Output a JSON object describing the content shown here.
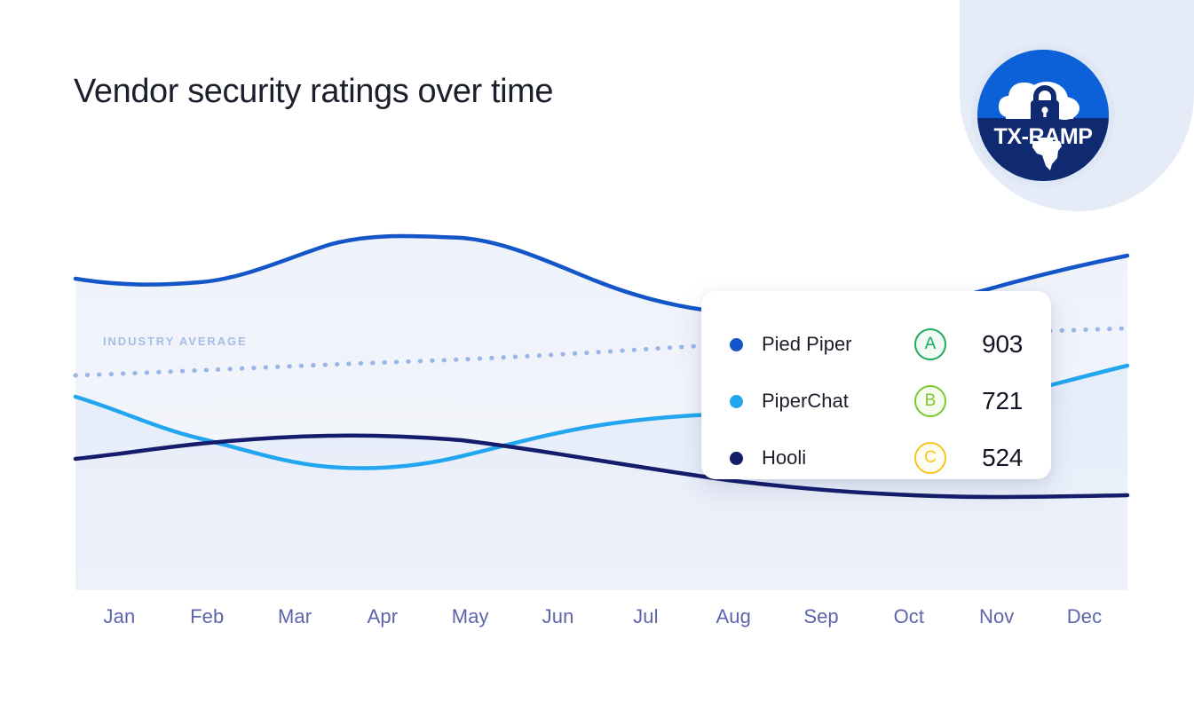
{
  "page": {
    "title": "Vendor security ratings over time",
    "background": "#ffffff"
  },
  "badge": {
    "name": "tx-ramp-certification-badge",
    "label": "TX-RAMP",
    "top_color": "#0d61d8",
    "bottom_color": "#102a72",
    "halo_color": "#e6ecf7",
    "icons": [
      "cloud-icon",
      "lock-icon",
      "texas-state-icon"
    ]
  },
  "chart_data": {
    "type": "area",
    "title": "Vendor security ratings over time",
    "xlabel": "",
    "ylabel": "",
    "grid": false,
    "legend_position": "overlay-card-right",
    "categories": [
      "Jan",
      "Feb",
      "Mar",
      "Apr",
      "May",
      "Jun",
      "Jul",
      "Aug",
      "Sep",
      "Oct",
      "Nov",
      "Dec"
    ],
    "ylim": [
      300,
      1000
    ],
    "series": [
      {
        "name": "Pied Piper",
        "color": "#1455c7",
        "grade": "A",
        "current_value": 903,
        "values": [
          812,
          800,
          818,
          876,
          918,
          915,
          856,
          830,
          828,
          836,
          872,
          903
        ]
      },
      {
        "name": "PiperChat",
        "color": "#23a6f0",
        "grade": "B",
        "current_value": 721,
        "values": [
          640,
          592,
          548,
          534,
          540,
          570,
          612,
          642,
          650,
          646,
          672,
          721
        ]
      },
      {
        "name": "Hooli",
        "color": "#151c6b",
        "grade": "C",
        "current_value": 524,
        "values": [
          528,
          542,
          556,
          562,
          560,
          548,
          530,
          512,
          500,
          496,
          498,
          504
        ]
      }
    ],
    "reference_line": {
      "label": "INDUSTRY AVERAGE",
      "style": "dotted",
      "color": "#9ab6e8",
      "values": [
        676,
        678,
        680,
        682,
        684,
        686,
        690,
        694,
        698,
        702,
        706,
        710
      ]
    }
  },
  "tooltip": {
    "rows": [
      {
        "name": "Pied Piper",
        "dot_color": "#1455c7",
        "grade": "A",
        "grade_color": "#1faa5e",
        "grade_bg": "#f2fbf6",
        "score": "903"
      },
      {
        "name": "PiperChat",
        "dot_color": "#23a6f0",
        "grade": "B",
        "grade_color": "#7dc832",
        "grade_bg": "#f7fcf0",
        "score": "721"
      },
      {
        "name": "Hooli",
        "dot_color": "#151c6b",
        "grade": "C",
        "grade_color": "#f9c421",
        "grade_bg": "#fffdf2",
        "score": "524"
      }
    ]
  },
  "axis": {
    "months": [
      "Jan",
      "Feb",
      "Mar",
      "Apr",
      "May",
      "Jun",
      "Jul",
      "Aug",
      "Sep",
      "Oct",
      "Nov",
      "Dec"
    ],
    "tick_color": "#5c65ab"
  }
}
